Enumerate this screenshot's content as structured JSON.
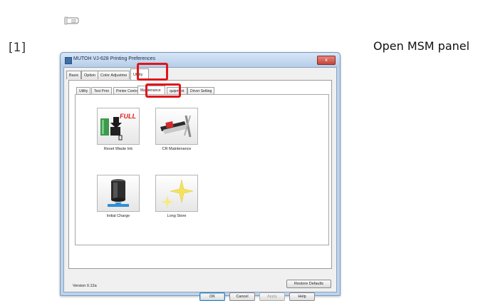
{
  "step_number": "[1]",
  "caption": "Open MSM panel",
  "window": {
    "title": "MUTOH VJ-628 Printing Preferences",
    "close_label": "x"
  },
  "tabs": [
    "Basic",
    "Option",
    "Color Adjustme",
    "Utility"
  ],
  "active_tab": "Utility",
  "sub_tabs": [
    "Utility",
    "Test Print",
    "Printer Contro",
    "Maintenance",
    "quipment",
    "Driver Setting"
  ],
  "active_sub_tab": "Maintenance",
  "tools": [
    {
      "label": "Reset Waste Ink",
      "icon": "waste-ink-full-icon",
      "overlay": "FULL"
    },
    {
      "label": "CR Maintenance",
      "icon": "cr-maintenance-icon"
    },
    {
      "label": "Initial Charge",
      "icon": "initial-charge-icon"
    },
    {
      "label": "Long Store",
      "icon": "long-store-sparkle-icon"
    }
  ],
  "version": "Version 0.12a",
  "buttons": {
    "restore": "Restore Defaults",
    "ok": "OK",
    "cancel": "Cancel",
    "apply": "Apply",
    "help": "Help"
  },
  "colors": {
    "highlight": "#e0161b",
    "window_frame": "#bcd3ec",
    "accent_blue": "#2f8fd6"
  }
}
